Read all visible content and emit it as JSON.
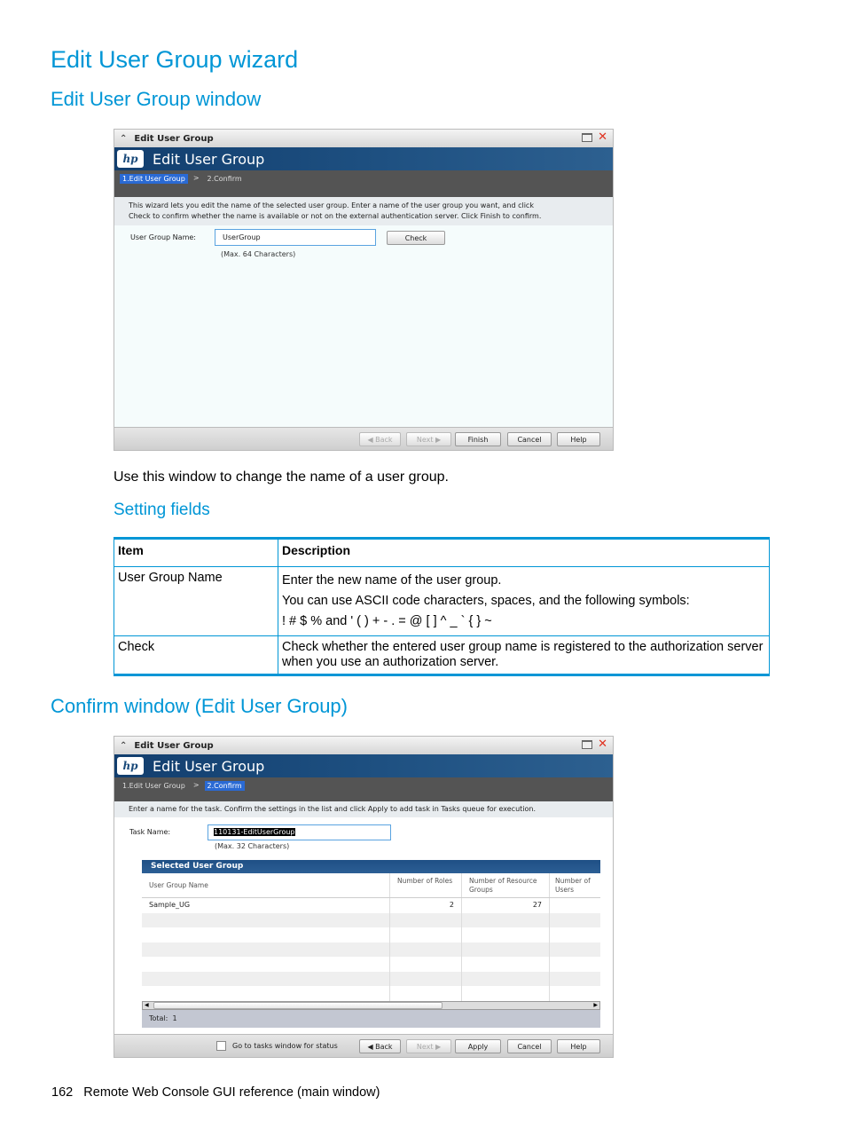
{
  "headings": {
    "title": "Edit User Group wizard",
    "section1": "Edit User Group window",
    "subsection": "Setting fields",
    "section2": "Confirm window (Edit User Group)"
  },
  "window1": {
    "titlebar": "Edit User Group",
    "logo": "hp",
    "banner_title": "Edit User Group",
    "steps": [
      {
        "label": "1.Edit User Group",
        "active": true
      },
      {
        "label": "2.Confirm",
        "active": false
      }
    ],
    "step_separator": ">",
    "intro_line1": "This wizard lets you edit the name of the selected user group. Enter a name of the user group you want, and click",
    "intro_line2": "Check to confirm whether the name is available or not on the external authentication server. Click Finish to confirm.",
    "field_label": "User Group Name:",
    "field_value": "UserGroup",
    "field_hint": "(Max. 64 Characters)",
    "check_button": "Check",
    "buttons": {
      "back": "Back",
      "next": "Next",
      "finish": "Finish",
      "cancel": "Cancel",
      "help": "Help"
    }
  },
  "description": "Use this window to change the name of a user group.",
  "fields_table": {
    "headers": [
      "Item",
      "Description"
    ],
    "rows": [
      {
        "item": "User Group Name",
        "desc": [
          "Enter the new name of the user group.",
          "You can use ASCII code characters, spaces, and the following symbols:",
          "! # $ % and ' ( ) + - . = @ [ ] ^ _ ` { } ~"
        ]
      },
      {
        "item": "Check",
        "desc": [
          "Check whether the entered user group name is registered to the authorization server when you use an authorization server."
        ]
      }
    ]
  },
  "window2": {
    "titlebar": "Edit User Group",
    "logo": "hp",
    "banner_title": "Edit User Group",
    "steps": [
      {
        "label": "1.Edit User Group",
        "active": false
      },
      {
        "label": "2.Confirm",
        "active": true
      }
    ],
    "step_separator": ">",
    "intro": "Enter a name for the task. Confirm the settings in the list and click Apply to add task in Tasks queue for execution.",
    "task_label": "Task Name:",
    "task_value": "110131-EditUserGroup",
    "task_hint": "(Max. 32 Characters)",
    "grid": {
      "title": "Selected User Group",
      "columns": [
        "User Group Name",
        "Number of Roles",
        "Number of Resource Groups",
        "Number of Users"
      ],
      "rows": [
        {
          "name": "Sample_UG",
          "roles": "2",
          "resource_groups": "27",
          "users": ""
        }
      ],
      "total_label": "Total:",
      "total_value": "1"
    },
    "checkbox_label": "Go to tasks window for status",
    "buttons": {
      "back": "Back",
      "next": "Next",
      "apply": "Apply",
      "cancel": "Cancel",
      "help": "Help"
    }
  },
  "footer": {
    "page_number": "162",
    "text": "Remote Web Console GUI reference (main window)"
  }
}
